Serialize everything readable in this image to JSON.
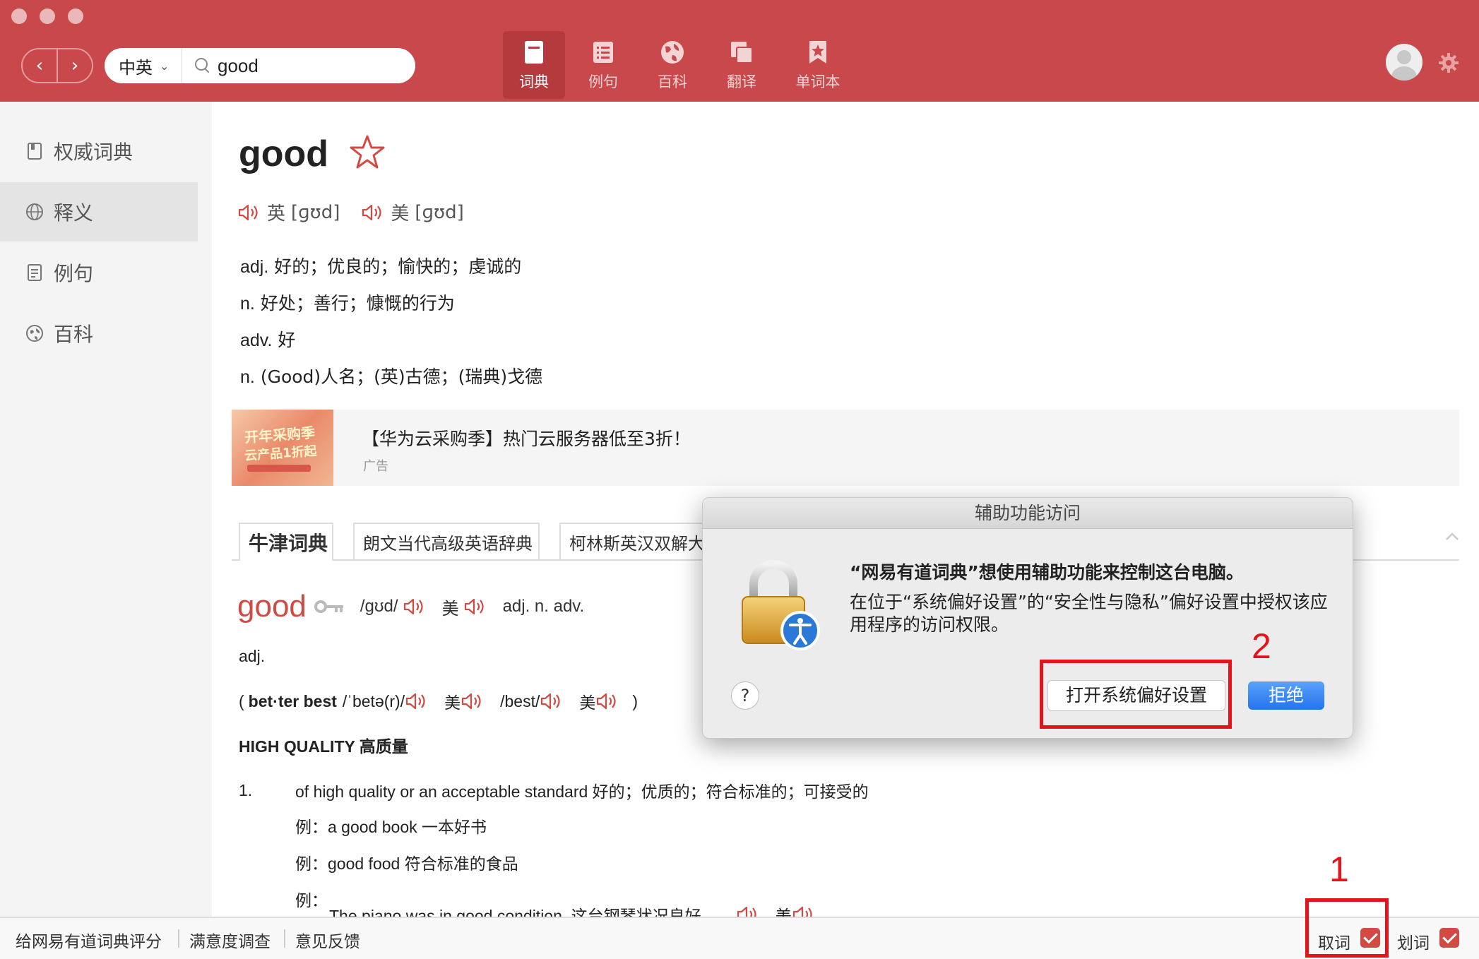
{
  "toolbar": {
    "lang": "中英",
    "search_value": "good",
    "tabs": [
      {
        "label": "词典",
        "icon": "dictionary-icon",
        "active": true
      },
      {
        "label": "例句",
        "icon": "list-icon"
      },
      {
        "label": "百科",
        "icon": "globe-icon"
      },
      {
        "label": "翻译",
        "icon": "translate-icon"
      },
      {
        "label": "单词本",
        "icon": "bookmark-star-icon"
      }
    ]
  },
  "sidebar": {
    "items": [
      {
        "label": "权威词典",
        "icon": "book-icon"
      },
      {
        "label": "释义",
        "icon": "globe-icon",
        "active": true
      },
      {
        "label": "例句",
        "icon": "document-icon"
      },
      {
        "label": "百科",
        "icon": "compass-icon"
      }
    ]
  },
  "word": {
    "headword": "good",
    "uk_label": "英",
    "uk_ipa": "[ɡʊd]",
    "us_label": "美",
    "us_ipa": "[ɡʊd]",
    "definitions": [
      {
        "pos": "adj.",
        "text": "好的；优良的；愉快的；虔诚的"
      },
      {
        "pos": "n.",
        "text": "好处；善行；慷慨的行为"
      },
      {
        "pos": "adv.",
        "text": "好"
      },
      {
        "pos": "n.",
        "text": "(Good)人名；(英)古德；(瑞典)戈德"
      }
    ]
  },
  "ad": {
    "text": "【华为云采购季】热门云服务器低至3折！",
    "label": "广告",
    "image_text_1": "开年采购季",
    "image_text_2": "云产品1折起"
  },
  "dict_tabs": [
    "牛津词典",
    "朗文当代高级英语辞典",
    "柯林斯英汉双解大"
  ],
  "oxford": {
    "headword": "good",
    "ipa": "/ɡʊd/",
    "us_label": "美",
    "pos": "adj. n. adv.",
    "pos_line": "adj.",
    "forms_open": "(",
    "forms_word": "bet·ter best",
    "forms_ipa1": "/ˈbetə(r)/",
    "forms_us1": "美",
    "forms_ipa2": "/best/",
    "forms_us2": "美",
    "forms_close": ")",
    "sense_heading": "HIGH QUALITY 高质量",
    "sense_num": "1.",
    "sense_text": "of high quality or an acceptable standard 好的；优质的；符合标准的；可接受的",
    "examples": [
      {
        "label": "例：",
        "text": "a good book 一本好书"
      },
      {
        "label": "例：",
        "text": "good food 符合标准的食品"
      },
      {
        "label": "例：",
        "text": "The piano was in good condition. 这台钢琴状况良好。"
      }
    ],
    "example_us": "美"
  },
  "bottombar": {
    "links": [
      "给网易有道词典评分",
      "满意度调查",
      "意见反馈"
    ],
    "qu_ci": "取词",
    "hua_ci": "划词"
  },
  "dialog": {
    "title": "辅助功能访问",
    "heading": "“网易有道词典”想使用辅助功能来控制这台电脑。",
    "body": "在位于“系统偏好设置”的“安全性与隐私”偏好设置中授权该应用程序的访问权限。",
    "help": "?",
    "open_button": "打开系统偏好设置",
    "deny_button": "拒绝"
  },
  "annotations": {
    "one": "1",
    "two": "2"
  },
  "colors": {
    "brand_red": "#c9484b",
    "accent_red": "#d14a43",
    "dialog_blue": "#2374f0",
    "annotation_red": "#e5141b"
  }
}
